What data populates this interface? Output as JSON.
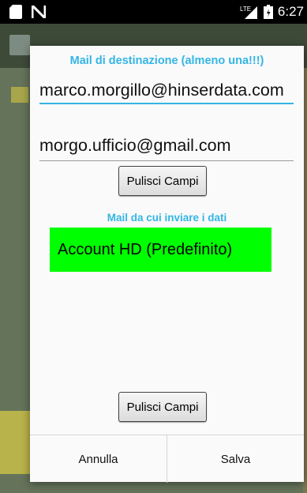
{
  "status_bar": {
    "network_label": "LTE",
    "time": "6:27",
    "icons": [
      "sd-card-icon",
      "n-notification-icon",
      "lte-signal-icon",
      "battery-icon"
    ]
  },
  "dialog": {
    "destination_header": "Mail di destinazione (almeno una!!!)",
    "email_1": "marco.morgillo@hinserdata.com",
    "email_2": "morgo.ufficio@gmail.com",
    "clear_button_1": "Pulisci Campi",
    "sender_header": "Mail da cui inviare i dati",
    "account": "Account HD (Predefinito)",
    "clear_button_2": "Pulisci Campi",
    "cancel_label": "Annulla",
    "save_label": "Salva"
  },
  "colors": {
    "accent": "#33b5e5",
    "account_highlight": "#00ff00"
  }
}
